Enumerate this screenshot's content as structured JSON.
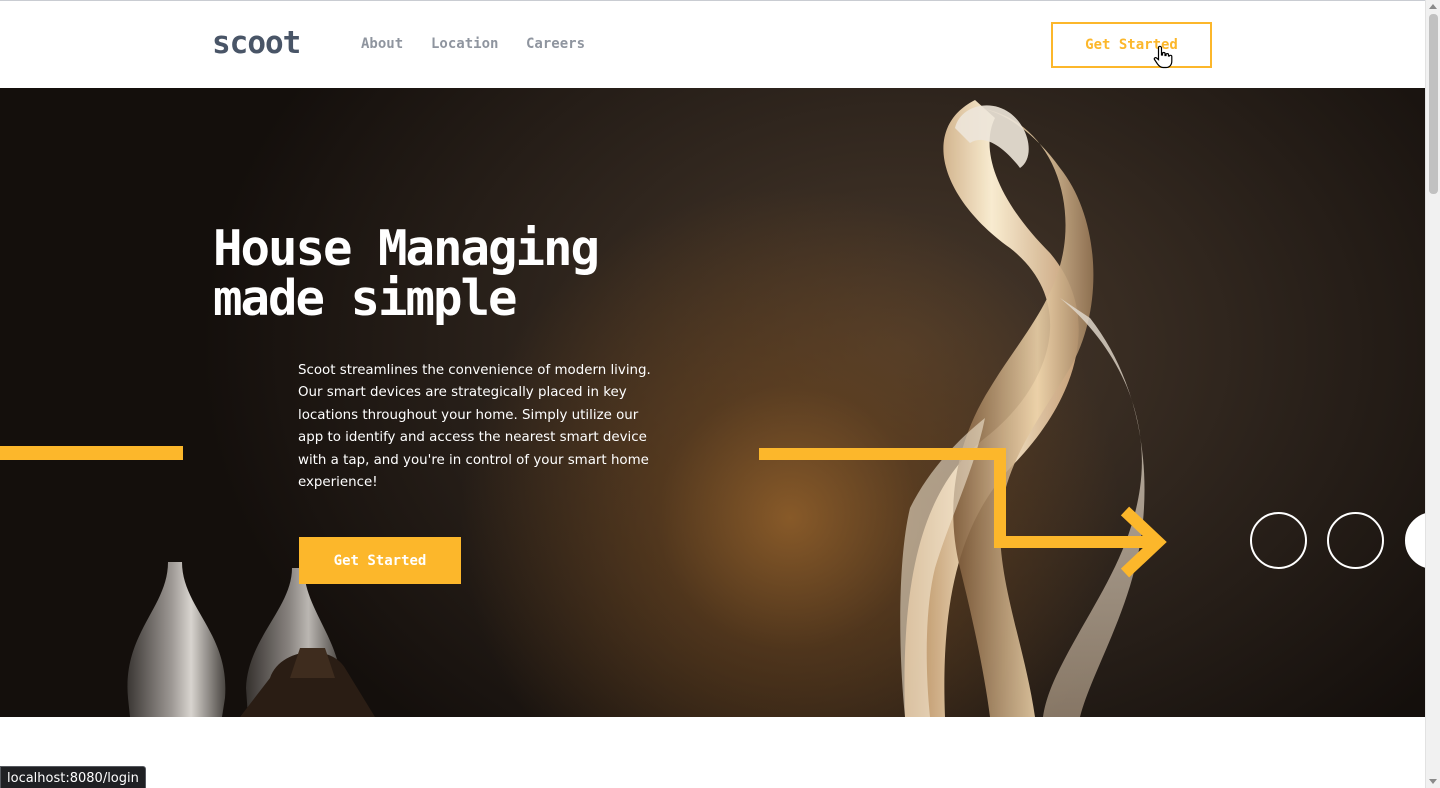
{
  "header": {
    "logo": "scoot",
    "nav": [
      "About",
      "Location",
      "Careers"
    ],
    "cta_label": "Get Started"
  },
  "hero": {
    "title_line1": "House Managing",
    "title_line2": "made simple",
    "description": "Scoot streamlines the convenience of modern living. Our smart devices are strategically placed in key locations throughout your home. Simply utilize our app to identify and access the nearest smart device with a tap, and you're in control of your smart home experience!",
    "cta_label": "Get Started"
  },
  "status_bar": {
    "url": "localhost:8080/login"
  },
  "colors": {
    "accent": "#fcb72b",
    "logo": "#495567",
    "nav_text": "#8f959f",
    "hero_text": "#ffffff"
  },
  "icons": {
    "cursor": "hand-pointer-icon",
    "arrow": "zigzag-arrow-icon"
  }
}
